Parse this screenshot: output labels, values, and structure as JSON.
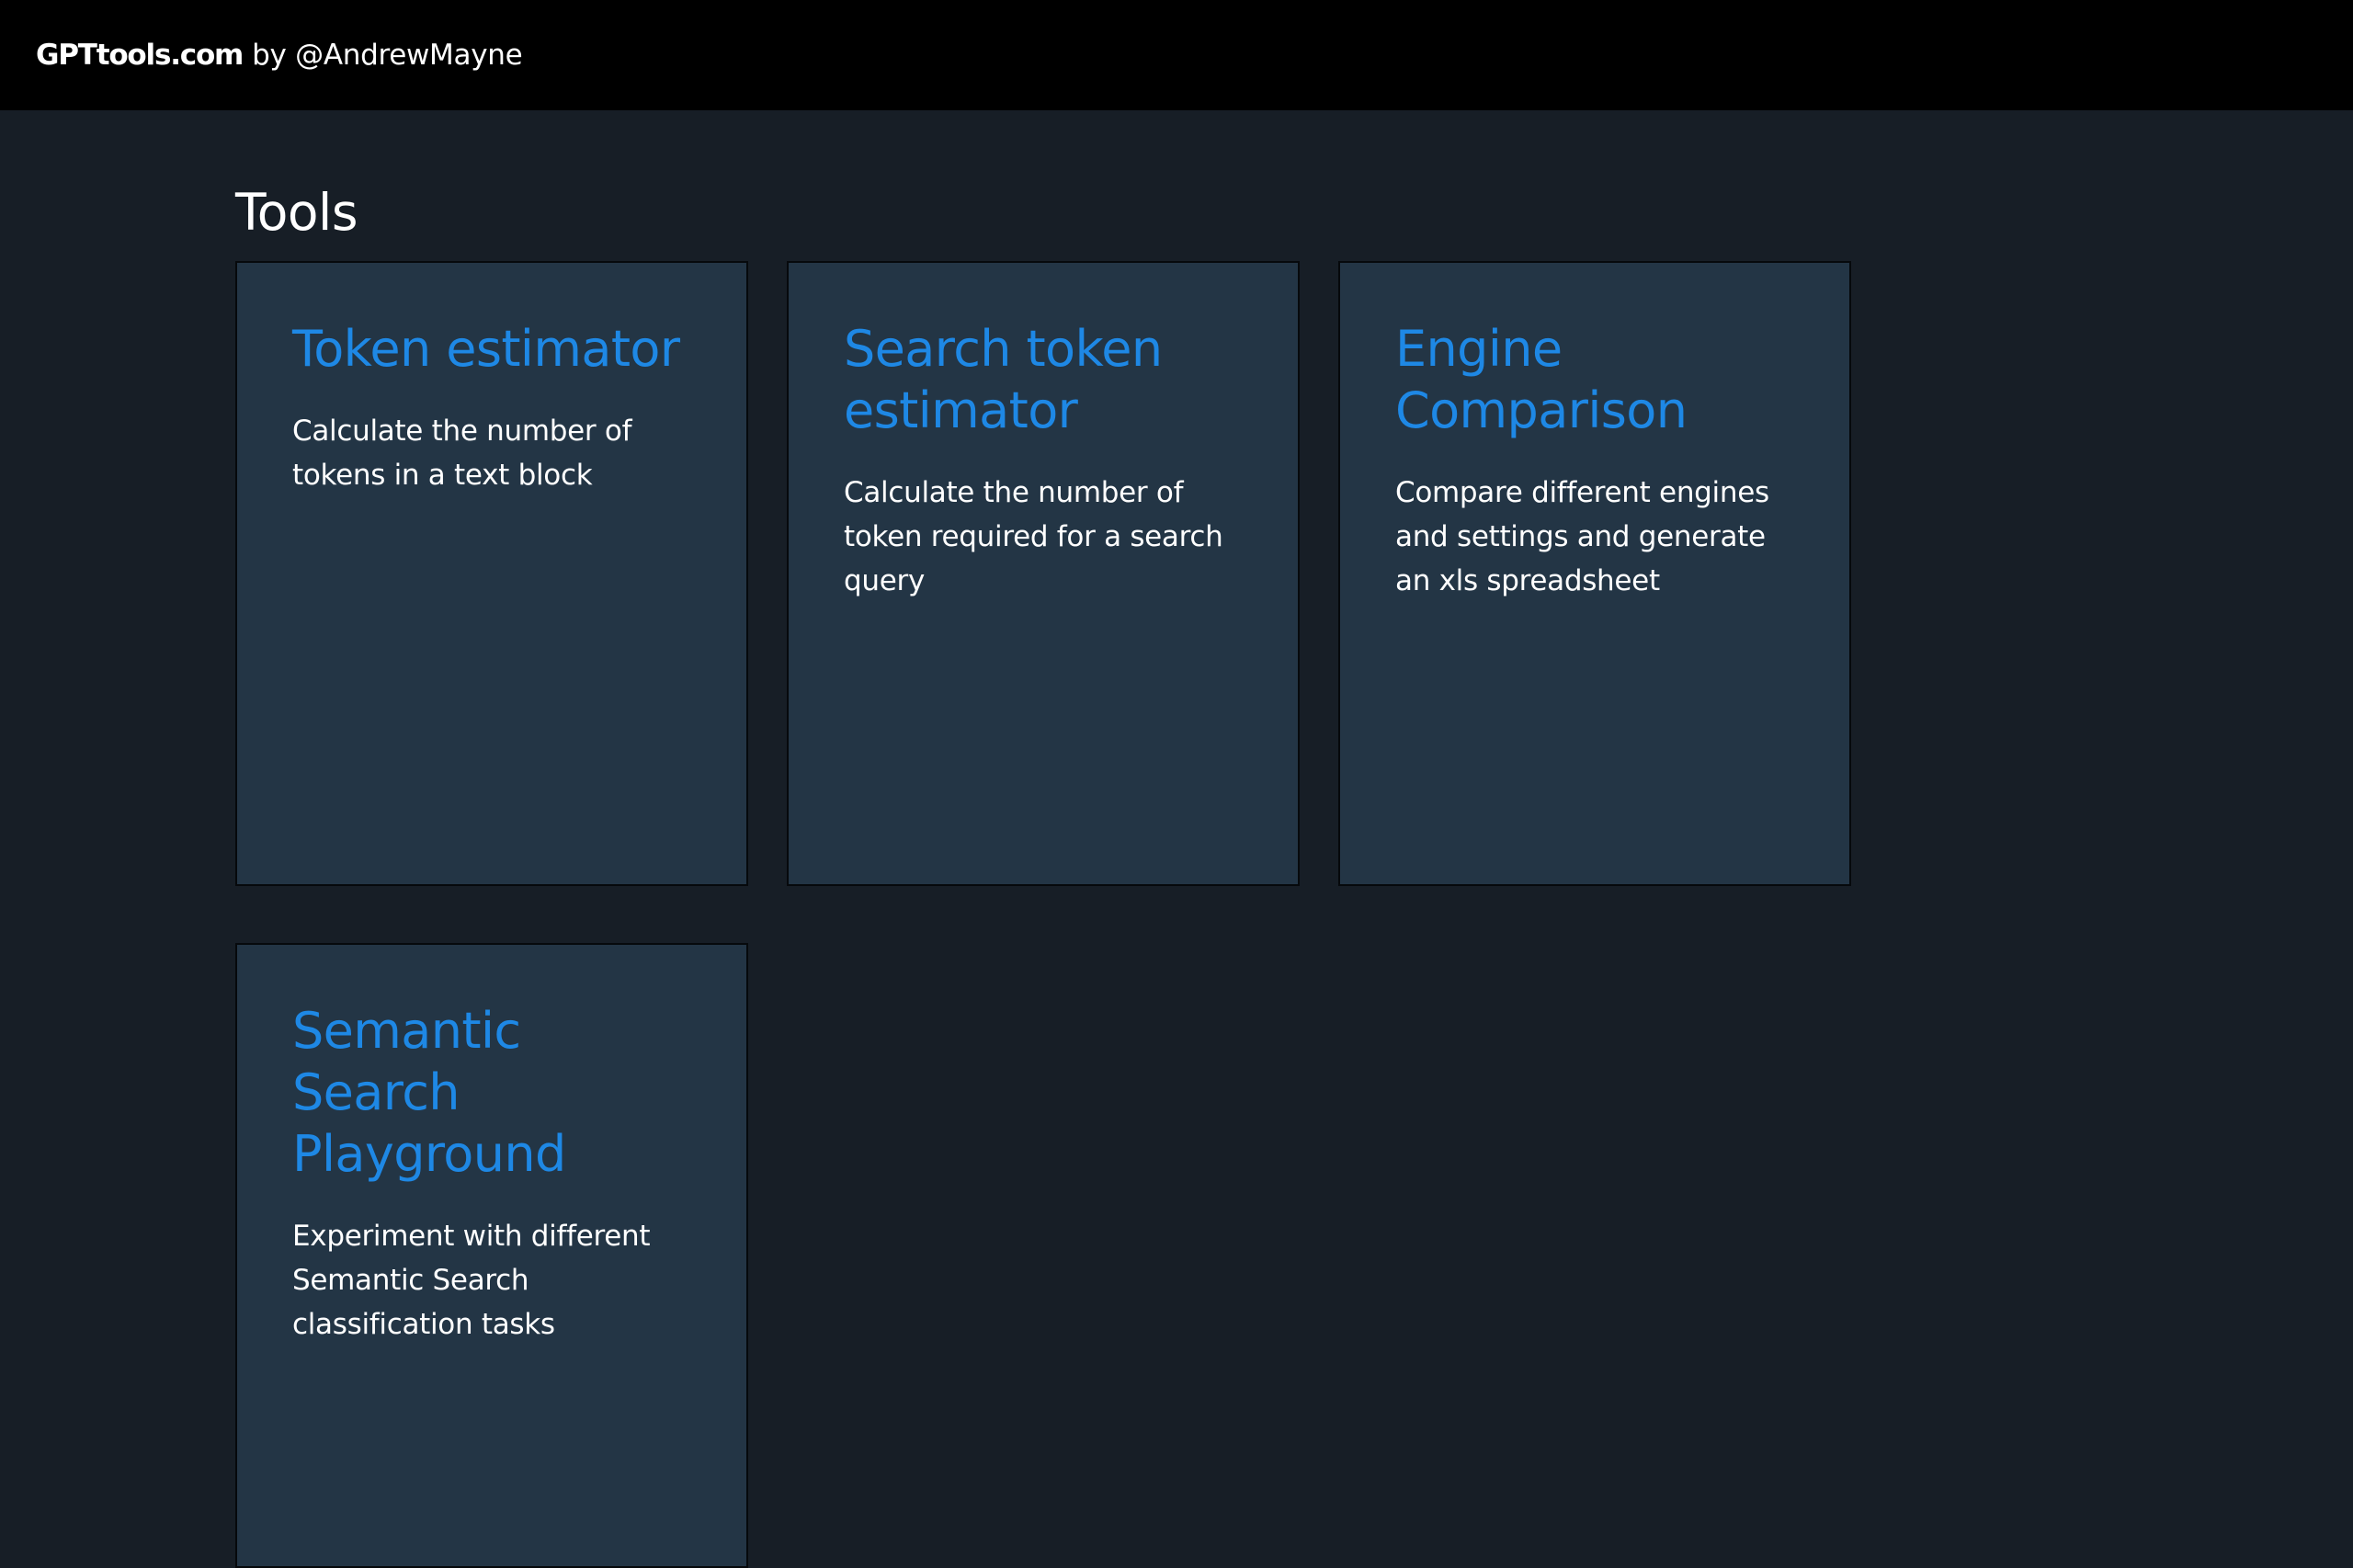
{
  "header": {
    "site": "GPTtools.com",
    "author": "by @AndrewMayne"
  },
  "main": {
    "title": "Tools",
    "tools": [
      {
        "title": "Token estimator",
        "description": "Calculate the number of tokens in a text block"
      },
      {
        "title": "Search token estimator",
        "description": "Calculate the number of token required for a search query"
      },
      {
        "title": "Engine Comparison",
        "description": "Compare different engines and settings and generate an xls spreadsheet"
      },
      {
        "title": "Semantic Search Playground",
        "description": "Experiment with different Semantic Search classification tasks"
      }
    ]
  },
  "colors": {
    "header_bg": "#000000",
    "page_bg": "#171e26",
    "card_bg": "#233545",
    "card_title": "#1e88e5",
    "text": "#ffffff"
  }
}
